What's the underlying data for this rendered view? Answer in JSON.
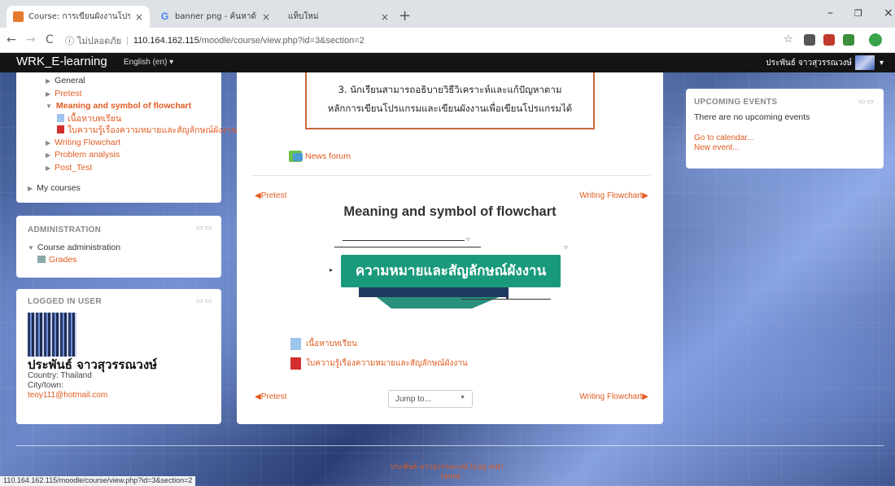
{
  "browser": {
    "tabs": [
      {
        "title": "Course: การเขียนผังงานโปรแกรม, Wr",
        "close": "×"
      },
      {
        "title": "banner png - ค้นหาด้วย Google",
        "close": "×"
      },
      {
        "title": "แท็บใหม่",
        "close": "×"
      }
    ],
    "new_tab": "+",
    "window_controls": {
      "minimize": "–",
      "maximize": "❐",
      "close": "×"
    },
    "nav": {
      "back": "←",
      "forward": "→",
      "reload": "C"
    },
    "security_label": "ไม่ปลอดภัย",
    "url_host": "110.164.162.115",
    "url_path": "/moodle/course/view.php?id=3&section=2",
    "status_url": "110.164.162.115/moodle/course/view.php?id=3&section=2"
  },
  "navbar": {
    "brand": "WRK_E-learning",
    "language": "English (en) ▾",
    "user_name": "ประพันธ์ จาวสุวรรณวงษ์",
    "caret": "▾"
  },
  "navigation": {
    "items": [
      {
        "label": "General"
      },
      {
        "label": "Pretest"
      },
      {
        "label": "Meaning and symbol of flowchart"
      },
      {
        "label": "Writing Flowchart"
      },
      {
        "label": "Problem analysis"
      },
      {
        "label": "Post_Test"
      }
    ],
    "subitems": [
      {
        "label": "เนื้อหาบทเรียน"
      },
      {
        "label": "ใบความรู้เรื่องความหมายและสัญลักษณ์ผังงาน"
      }
    ],
    "my_courses": "My courses"
  },
  "administration": {
    "title": "ADMINISTRATION",
    "course_admin": "Course administration",
    "grades": "Grades"
  },
  "logged_in": {
    "title": "LOGGED IN USER",
    "name": "ประพันธ์ จาวสุวรรณวงษ์",
    "country": "Country: Thailand",
    "city": "City/town:",
    "email": "teoy111@hotmail.com"
  },
  "main": {
    "objective_line1": "3. นักเรียนสามารถอธิบายวิธีวิเคราะห์และแก้ปัญหาตาม",
    "objective_line2": "หลักการเขียนโปรแกรมและเขียนผังงานเพื่อเขียนโปรแกรมได้",
    "news_forum": "News forum",
    "prev": "◀Pretest",
    "next": "Writing Flowchart▶",
    "section_title": "Meaning and symbol of flowchart",
    "banner_text": "ความหมายและสัญลักษณ์ผังงาน",
    "resource1": "เนื้อหาบทเรียน",
    "resource2": "ใบความรู้เรื่องความหมายและสัญลักษณ์ผังงาน",
    "jump_to": "Jump to...",
    "jump_caret": "▼"
  },
  "events": {
    "title": "UPCOMING EVENTS",
    "none": "There are no upcoming events",
    "calendar": "Go to calendar...",
    "new_event": "New event..."
  },
  "footer": {
    "user_line": "ประพันธ์ จาวสุวรรณวงษ์ (Log out)",
    "home": "Home"
  },
  "colors": {
    "link": "#e25b20",
    "navbar": "#141414",
    "banner_green": "#1a9a7c"
  }
}
